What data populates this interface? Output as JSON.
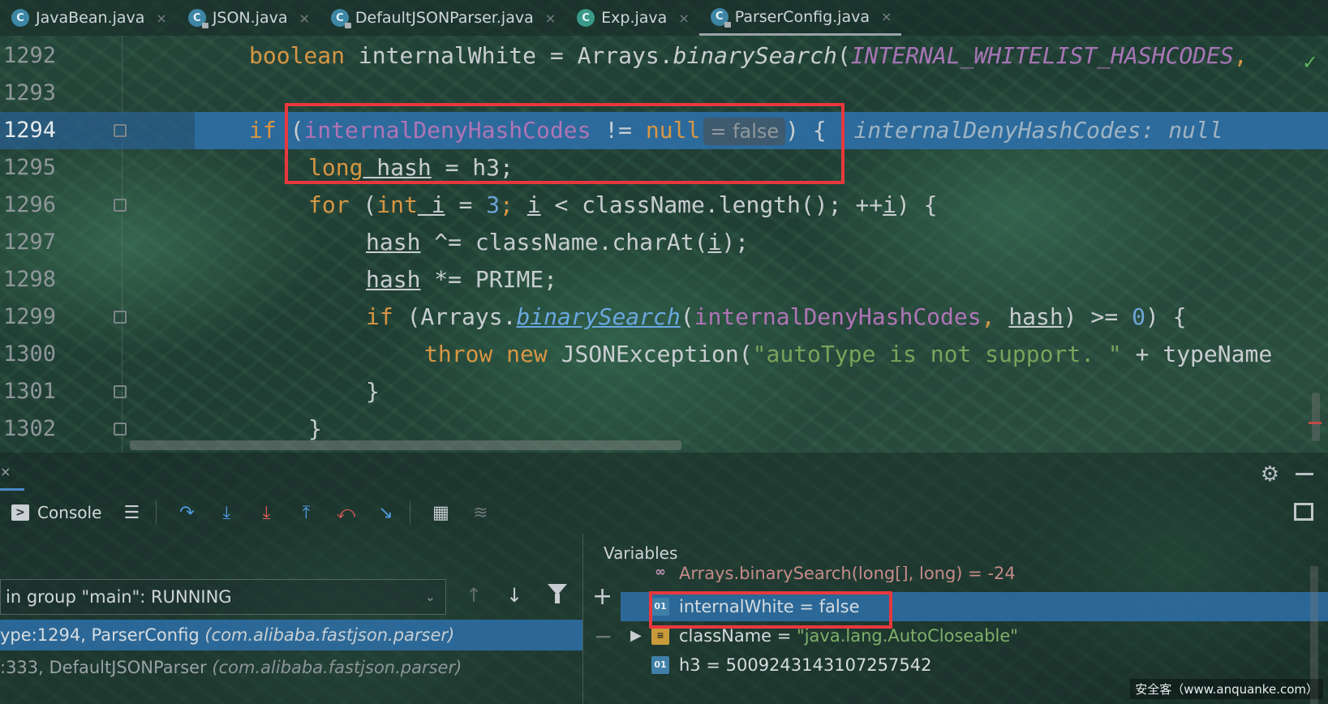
{
  "tabs": [
    {
      "icon": "C",
      "label": "JavaBean.java",
      "close": "×"
    },
    {
      "icon": "C",
      "label": "JSON.java",
      "close": "×"
    },
    {
      "icon": "C",
      "label": "DefaultJSONParser.java",
      "close": "×"
    },
    {
      "icon": "C",
      "label": "Exp.java",
      "close": "×"
    },
    {
      "icon": "C",
      "label": "ParserConfig.java",
      "close": "×"
    }
  ],
  "editor": {
    "current_line": 1294,
    "lines": [
      {
        "num": "1292",
        "tokens": [
          "boolean",
          " internalWhite = Arrays.",
          "binarySearch",
          "(",
          "INTERNAL_WHITELIST_HASHCODES",
          ","
        ]
      },
      {
        "num": "1293"
      },
      {
        "num": "1294",
        "tokens": [
          "if",
          " (",
          "internalDenyHashCodes",
          " != ",
          "null",
          "= false",
          ") {",
          "internalDenyHashCodes: null"
        ]
      },
      {
        "num": "1295",
        "tokens": [
          "long",
          " hash",
          " = h3;"
        ]
      },
      {
        "num": "1296",
        "tokens": [
          "for",
          " (",
          "int",
          " i",
          " = ",
          "3",
          "; ",
          "i",
          " < className.length(); ++",
          "i",
          ") {"
        ]
      },
      {
        "num": "1297",
        "tokens": [
          "hash",
          " ^= className.charAt(",
          "i",
          ");"
        ]
      },
      {
        "num": "1298",
        "tokens": [
          "hash",
          " *= PRIME;"
        ]
      },
      {
        "num": "1299",
        "tokens": [
          "if",
          " (Arrays.",
          "binarySearch",
          "(",
          "internalDenyHashCodes",
          ", ",
          "hash",
          ") >= ",
          "0",
          ") {"
        ]
      },
      {
        "num": "1300",
        "tokens": [
          "throw",
          " ",
          "new",
          " JSONException(",
          "\"autoType is not support. \"",
          " + typeName"
        ]
      },
      {
        "num": "1301",
        "tokens": [
          "}"
        ]
      },
      {
        "num": "1302",
        "tokens": [
          "}"
        ]
      }
    ],
    "check_mark": "✓"
  },
  "debugger": {
    "console_label": "Console",
    "thread_select": "in group \"main\": RUNNING",
    "frames": [
      {
        "location": "ype:1294, ParserConfig ",
        "package": "(com.alibaba.fastjson.parser)"
      },
      {
        "location": ":333, DefaultJSONParser ",
        "package": "(com.alibaba.fastjson.parser)"
      }
    ],
    "variables_title": "Variables",
    "variables": [
      {
        "icon": "∞",
        "text": "Arrays.binarySearch(long[], long) = -24"
      },
      {
        "icon": "01",
        "text": "internalWhite = false"
      },
      {
        "icon": "≡",
        "name": "className = ",
        "value": "\"java.lang.AutoCloseable\""
      },
      {
        "icon": "01",
        "text": "h3 = 5009243143107257542"
      }
    ]
  },
  "watermark": "安全客（www.anquanke.com）",
  "colors": {
    "keyword": "#d89644",
    "field": "#b074b6",
    "number": "#6ea5d8",
    "string": "#7aa35a",
    "selection": "#2d6ea5",
    "highlight_box": "#e8383d"
  }
}
